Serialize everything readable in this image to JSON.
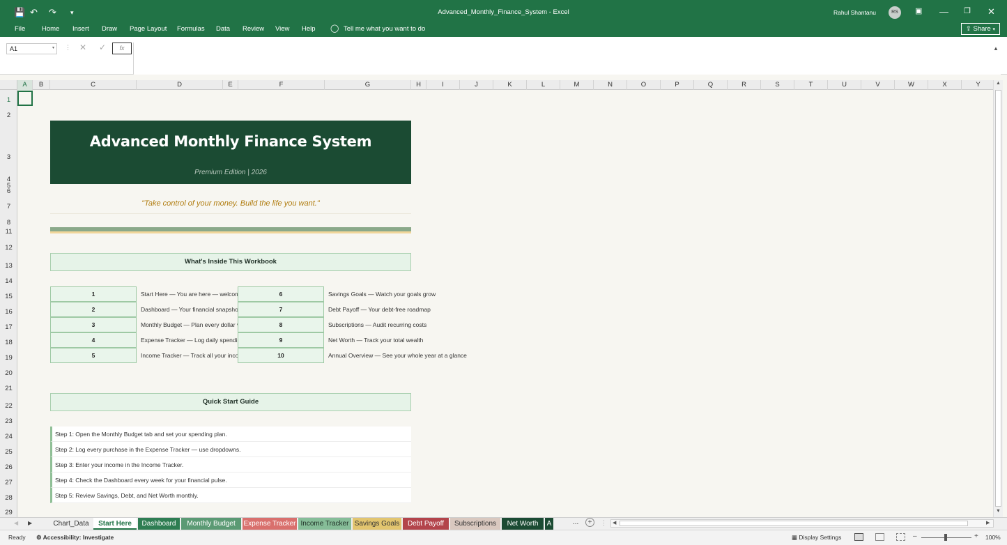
{
  "window": {
    "title": "Advanced_Monthly_Finance_System  -  Excel",
    "user_name": "Rahul Shantanu",
    "user_initials": "RS",
    "share_label": "Share",
    "accent_color": "#217346"
  },
  "ribbon": {
    "tabs": [
      "File",
      "Home",
      "Insert",
      "Draw",
      "Page Layout",
      "Formulas",
      "Data",
      "Review",
      "View",
      "Help"
    ],
    "tell_me": "Tell me what you want to do"
  },
  "formula_bar": {
    "name_box": "A1",
    "fx_label": "fx",
    "formula": ""
  },
  "grid": {
    "columns": [
      "A",
      "B",
      "C",
      "D",
      "E",
      "F",
      "G",
      "H",
      "I",
      "J",
      "K",
      "L",
      "M",
      "N",
      "O",
      "P",
      "Q",
      "R",
      "S",
      "T",
      "U",
      "V",
      "W",
      "X",
      "Y"
    ],
    "rows": [
      "1",
      "2",
      "3",
      "4",
      "5",
      "6",
      "7",
      "8",
      "11",
      "12",
      "13",
      "14",
      "15",
      "16",
      "17",
      "18",
      "19",
      "20",
      "21",
      "22",
      "23",
      "24",
      "25",
      "26",
      "27",
      "28",
      "29"
    ]
  },
  "sheet": {
    "title": "Advanced Monthly Finance System",
    "subtitle": "Premium Edition  |  2026",
    "tagline": "\"Take control of your money. Build the life you want.\"",
    "section_inside": "What's Inside This Workbook",
    "contents_left": [
      {
        "num": "1",
        "desc": "Start Here  —  You are here — welcom"
      },
      {
        "num": "2",
        "desc": "Dashboard  —  Your financial snapshot"
      },
      {
        "num": "3",
        "desc": "Monthly Budget  —  Plan every dollar v"
      },
      {
        "num": "4",
        "desc": "Expense Tracker  —  Log daily spending"
      },
      {
        "num": "5",
        "desc": "Income Tracker  —  Track all your inco"
      }
    ],
    "contents_right": [
      {
        "num": "6",
        "desc": "Savings Goals  —  Watch your goals grow"
      },
      {
        "num": "7",
        "desc": "Debt Payoff  —  Your debt-free roadmap"
      },
      {
        "num": "8",
        "desc": "Subscriptions  —  Audit recurring costs"
      },
      {
        "num": "9",
        "desc": "Net Worth  —  Track your total wealth"
      },
      {
        "num": "10",
        "desc": "Annual Overview  —  See your whole year at a glance"
      }
    ],
    "section_quickstart": "Quick Start Guide",
    "steps": [
      "Step 1: Open the Monthly Budget tab and set your spending plan.",
      "Step 2: Log every purchase in the Expense Tracker — use dropdowns.",
      "Step 3: Enter your income in the Income Tracker.",
      "Step 4: Check the Dashboard every week for your financial pulse.",
      "Step 5: Review Savings, Debt, and Net Worth monthly."
    ]
  },
  "sheet_tabs": [
    {
      "label": "Chart_Data",
      "bg": "#efefef",
      "fg": "#333333",
      "active": false
    },
    {
      "label": "Start Here",
      "bg": "#ffffff",
      "fg": "#217346",
      "active": true
    },
    {
      "label": "Dashboard",
      "bg": "#2e7d52",
      "fg": "#ffffff",
      "active": false
    },
    {
      "label": "Monthly Budget",
      "bg": "#5b9a74",
      "fg": "#ffffff",
      "active": false
    },
    {
      "label": "Expense Tracker",
      "bg": "#d9706d",
      "fg": "#ffffff",
      "active": false
    },
    {
      "label": "Income Tracker",
      "bg": "#86bd98",
      "fg": "#1e2e25",
      "active": false
    },
    {
      "label": "Savings Goals",
      "bg": "#e2c56f",
      "fg": "#333333",
      "active": false
    },
    {
      "label": "Debt Payoff",
      "bg": "#b3444b",
      "fg": "#ffffff",
      "active": false
    },
    {
      "label": "Subscriptions",
      "bg": "#d9c8bf",
      "fg": "#333333",
      "active": false
    },
    {
      "label": "Net Worth",
      "bg": "#1b4b33",
      "fg": "#ffffff",
      "active": false
    },
    {
      "label": "A",
      "bg": "#1b4b33",
      "fg": "#ffffff",
      "active": false
    }
  ],
  "tab_overflow": "...",
  "status": {
    "ready": "Ready",
    "accessibility": "Accessibility: Investigate",
    "display_settings": "Display Settings",
    "zoom": "100%"
  }
}
